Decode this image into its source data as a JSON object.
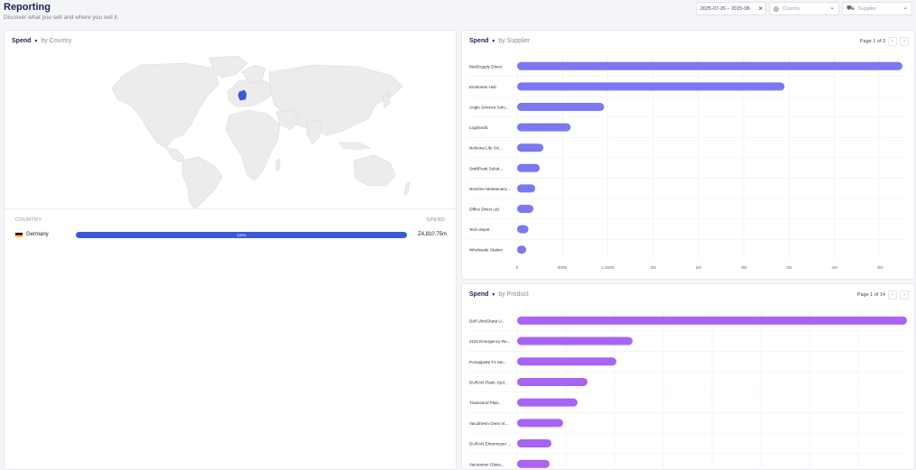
{
  "header": {
    "title": "Reporting",
    "subtitle": "Discover what you sell and where you sell it."
  },
  "filters": {
    "date_range": "2025-07-26 – 2025-08-",
    "country_placeholder": "Country",
    "supplier_placeholder": "Supplier",
    "icons": {
      "country": "globe-icon",
      "supplier": "truck-icon",
      "dropdown": "chevron-down-icon",
      "clear": "close-icon"
    }
  },
  "country_panel": {
    "metric": "Spend",
    "by": "by Country",
    "col_country": "COUNTRY",
    "col_spend": "SPEND",
    "highlight_color": "#3a5bd9",
    "rows": [
      {
        "name": "Germany",
        "share": "100%",
        "share_fraction": 1.0,
        "spend": "Z4,810.75m"
      }
    ]
  },
  "supplier_panel": {
    "metric": "Spend",
    "by": "by Supplier",
    "page": "Page 1 of 3",
    "chart_data": {
      "type": "bar",
      "orientation": "horizontal",
      "categories": [
        "MedSupply Direct",
        "Einstones Hub",
        "Angle Science Solu...",
        "Logimedic",
        "Nelsona Life Sci...",
        "SwiftPeak Soluti...",
        "NeoGen Maintenanc...",
        "Office Direct Ltd.",
        "Tech depot",
        "Wholesale Station"
      ],
      "values": [
        4250000,
        2950000,
        960000,
        590000,
        290000,
        250000,
        200000,
        180000,
        125000,
        100000
      ],
      "xlim": [
        0,
        4300000
      ],
      "ticks": [
        0,
        500000,
        1000000,
        1500000,
        2000000,
        2500000,
        3000000,
        3500000,
        4000000
      ],
      "tick_labels": [
        "0",
        "500K",
        "1,000K",
        "2M",
        "2M",
        "3M",
        "3M",
        "4M",
        "4M"
      ],
      "color": "#7b78f2",
      "grid": true
    }
  },
  "product_panel": {
    "metric": "Spend",
    "by": "by Product",
    "page": "Page 1 of 14",
    "chart_data": {
      "type": "bar",
      "orientation": "horizontal",
      "categories": [
        "Dell UltraSharp U...",
        "2110 Emergency Re...",
        "Pompipette F1 Mu...",
        "DURAN Flask, Kjel...",
        "Transcend Plati...",
        "Vacutherm Oven Vi...",
        "DURAN Erlenmeyer ...",
        "Vacutainer Glass..."
      ],
      "values": [
        4320000,
        1280000,
        1100000,
        780000,
        670000,
        510000,
        380000,
        360000
      ],
      "xlim": [
        0,
        4320000
      ],
      "color": "#a864f3",
      "grid": true
    }
  }
}
